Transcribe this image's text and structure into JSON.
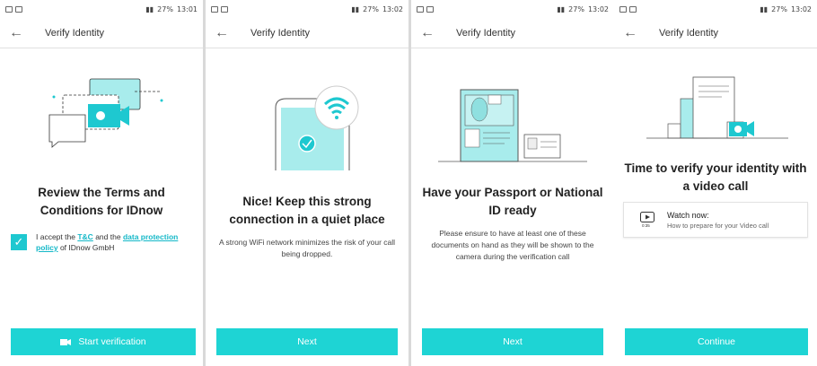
{
  "status_bars": [
    {
      "battery": "27%",
      "time": "13:01"
    },
    {
      "battery": "27%",
      "time": "13:02"
    },
    {
      "battery": "27%",
      "time": "13:02"
    },
    {
      "battery": "27%",
      "time": "13:02"
    }
  ],
  "screens": [
    {
      "appbar_title": "Verify Identity",
      "title": "Review the Terms and Conditions for IDnow",
      "accept": {
        "prefix": "I accept the",
        "tc_link": "T&C",
        "middle": "and the",
        "policy_link": "data protection policy",
        "suffix": "of IDnow GmbH"
      },
      "button": "Start verification",
      "button_icon": "video-camera-icon"
    },
    {
      "appbar_title": "Verify Identity",
      "title": "Nice! Keep this strong connection in a quiet place",
      "description": "A strong WiFi network minimizes the risk of your call being dropped.",
      "button": "Next"
    },
    {
      "appbar_title": "Verify Identity",
      "title": "Have your Passport or National ID ready",
      "description": "Please ensure to have at least one of these documents on hand as they will be shown to the camera during the verification call",
      "button": "Next"
    },
    {
      "appbar_title": "Verify Identity",
      "title": "Time to verify your identity with a video call",
      "watch": {
        "title": "Watch now:",
        "subtitle": "How to prepare for your Video call",
        "icon_caption": "0:35"
      },
      "button": "Continue"
    }
  ],
  "colors": {
    "accent": "#1ed4d4",
    "link": "#14b8c8",
    "illustration": "#a8ecec"
  }
}
